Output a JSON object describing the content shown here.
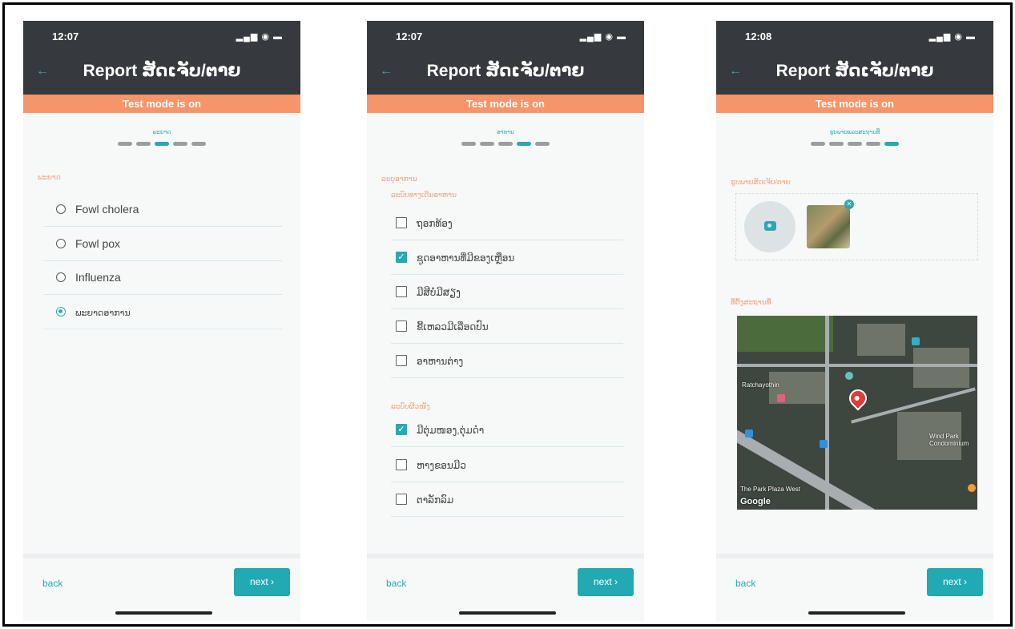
{
  "screens": [
    {
      "status_time": "12:07",
      "title": "Report ສັດເຈັບ/ຕາຍ",
      "test_banner": "Test mode is on",
      "step_label": "ພະຍາດ",
      "section_label": "ພະຍາດ",
      "options": [
        {
          "label": "Fowl cholera",
          "selected": false
        },
        {
          "label": "Fowl pox",
          "selected": false
        },
        {
          "label": "Influenza",
          "selected": false
        },
        {
          "label": "ພະຍາດອາການ",
          "selected": true
        }
      ],
      "back_label": "back",
      "next_label": "next ›"
    },
    {
      "status_time": "12:07",
      "title": "Report ສັດເຈັບ/ຕາຍ",
      "test_banner": "Test mode is on",
      "step_label": "ອາການ",
      "section_label": "ລະບຸອາການ",
      "group1_label": "ລະບົບທາງເດີນອາຫານ",
      "group1_items": [
        {
          "label": "ຖອກທ້ອງ",
          "checked": false
        },
        {
          "label": "ຊູດອາຫານທີ່ມີຂອງເຫຼືອນ",
          "checked": true
        },
        {
          "label": "ມີສີບໍ່ມີສຽງ",
          "checked": false
        },
        {
          "label": "ຂີ້ເຫລວມີເລືອດປົນ",
          "checked": false
        },
        {
          "label": "ອາຫານຕ່າງ",
          "checked": false
        }
      ],
      "group2_label": "ລະບົບຜິວໜັງ",
      "group2_items": [
        {
          "label": "ມີຕຸ່ມໜອງ,ຕຸ່ມດໍາ",
          "checked": true
        },
        {
          "label": "ຫາງຂອນມີວ",
          "checked": false
        },
        {
          "label": "ຕາລັກລົມ",
          "checked": false
        }
      ],
      "back_label": "back",
      "next_label": "next ›"
    },
    {
      "status_time": "12:08",
      "title": "Report ສັດເຈັບ/ຕາຍ",
      "test_banner": "Test mode is on",
      "step_label": "ຮູບພາບແລະສະຖານທີ່",
      "photo_section_label": "ຮູບພາບສັດເຈັບ/ຕາຍ",
      "location_section_label": "ທີ່ຕັ້ງສະຖານທີ່",
      "map_labels": [
        "Ratchayothin",
        "Wind Park Condominium",
        "The Park Plaza West",
        "Google"
      ],
      "back_label": "back",
      "next_label": "next ›"
    }
  ]
}
